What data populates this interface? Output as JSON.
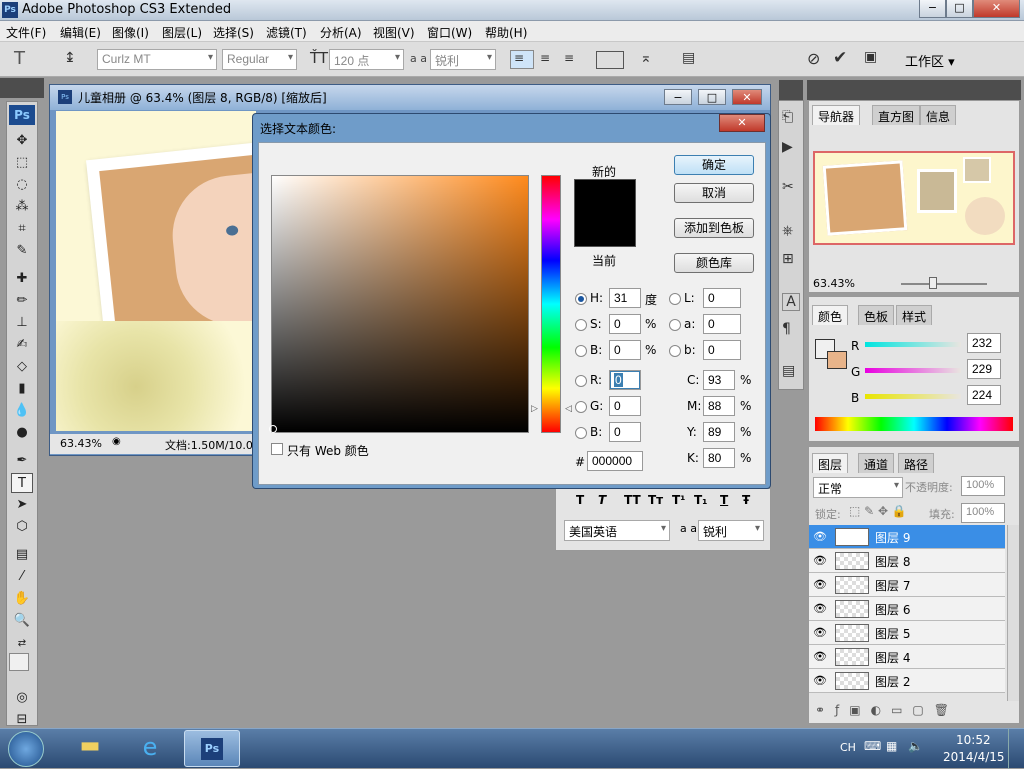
{
  "window": {
    "app_title": "Adobe Photoshop CS3 Extended",
    "logo_text": "Ps",
    "min": "−",
    "max": "□",
    "close": "✕"
  },
  "menu": {
    "items": [
      "文件(F)",
      "编辑(E)",
      "图像(I)",
      "图层(L)",
      "选择(S)",
      "滤镜(T)",
      "分析(A)",
      "视图(V)",
      "窗口(W)",
      "帮助(H)"
    ]
  },
  "options": {
    "font_family": "Curlz MT",
    "font_style": "Regular",
    "font_size": "120 点",
    "aa_label": "a a",
    "antialias": "锐利",
    "color_hex": "#000000",
    "workspace": "工作区 ▾"
  },
  "toolbox": {
    "logo": "Ps"
  },
  "document": {
    "title": "儿童相册 @ 63.4% (图层 8, RGB/8) [缩放后]",
    "zoom": "63.43%",
    "doc_info": "文档:1.50M/10.0"
  },
  "dialog": {
    "title": "选择文本颜色:",
    "new_label": "新的",
    "current_label": "当前",
    "ok": "确定",
    "cancel": "取消",
    "add_swatch": "添加到色板",
    "color_libs": "颜色库",
    "web_only": "只有 Web 颜色",
    "hsb": {
      "h_label": "H:",
      "h": "31",
      "h_unit": "度",
      "s_label": "S:",
      "s": "0",
      "s_unit": "%",
      "b_label": "B:",
      "b": "0",
      "b_unit": "%"
    },
    "rgb": {
      "r_label": "R:",
      "r": "0",
      "g_label": "G:",
      "g": "0",
      "b_label": "B:",
      "b": "0"
    },
    "lab": {
      "l_label": "L:",
      "l": "0",
      "a_label": "a:",
      "a": "0",
      "b_label": "b:",
      "b": "0"
    },
    "cmyk": {
      "c_label": "C:",
      "c": "93",
      "m_label": "M:",
      "m": "88",
      "y_label": "Y:",
      "y": "89",
      "k_label": "K:",
      "k": "80",
      "unit": "%"
    },
    "hex_label": "#",
    "hex": "000000",
    "selected_hue_color": "#ff8a1c"
  },
  "char_panel": {
    "language": "美国英语",
    "aa_label": "a a",
    "antialias": "锐利",
    "styles": [
      "T",
      "T",
      "TT",
      "Tт",
      "T¹",
      "T₁",
      "T",
      "Ŧ"
    ]
  },
  "navigator": {
    "tabs": [
      "导航器",
      "直方图",
      "信息"
    ],
    "zoom": "63.43%"
  },
  "color_panel": {
    "tabs": [
      "颜色",
      "色板",
      "样式"
    ],
    "r_label": "R",
    "r": "232",
    "g_label": "G",
    "g": "229",
    "b_label": "B",
    "b": "224",
    "fg": "#000000",
    "bg": "#e8b48a"
  },
  "layers_panel": {
    "tabs": [
      "图层",
      "通道",
      "路径"
    ],
    "blend_mode": "正常",
    "opacity_label": "不透明度:",
    "opacity": "100%",
    "lock_label": "锁定:",
    "fill_label": "填充:",
    "fill": "100%",
    "layers": [
      {
        "name": "图层 9",
        "selected": true,
        "type": "text"
      },
      {
        "name": "图层 8",
        "selected": false,
        "type": "pixel"
      },
      {
        "name": "图层 7",
        "selected": false,
        "type": "pixel"
      },
      {
        "name": "图层 6",
        "selected": false,
        "type": "pixel"
      },
      {
        "name": "图层 5",
        "selected": false,
        "type": "pixel"
      },
      {
        "name": "图层 4",
        "selected": false,
        "type": "pixel"
      },
      {
        "name": "图层 2",
        "selected": false,
        "type": "pixel"
      }
    ]
  },
  "taskbar": {
    "lang": "CH",
    "time": "10:52",
    "date": "2014/4/15",
    "ps_label": "Ps"
  }
}
